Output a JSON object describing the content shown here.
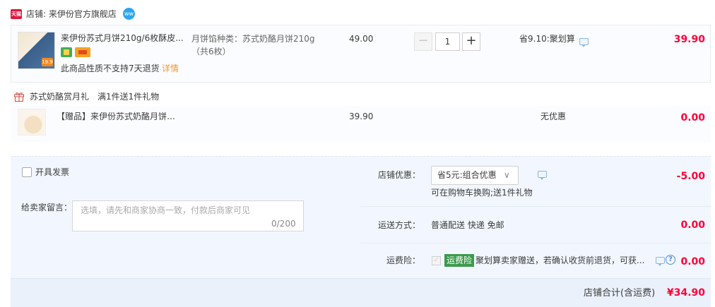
{
  "shop": {
    "badge": "天猫",
    "name": "店铺: 来伊份官方旗舰店",
    "chat_icon": "wangwang-icon"
  },
  "item": {
    "thumb_price": "19.9",
    "title": "来伊份苏式月饼210g/6枚酥皮...",
    "sku_line1": "月饼馅种类：苏式奶酪月饼210g",
    "sku_line2": "（共6枚）",
    "no_return": "此商品性质不支持7天退货",
    "detail": "详情",
    "unit_price": "49.00",
    "qty_minus": "−",
    "qty": "1",
    "qty_plus": "+",
    "promo": "省9.10:聚划算",
    "subtotal": "39.90"
  },
  "gift": {
    "section_title": "苏式奶酪赏月礼　满1件送1件礼物",
    "title": "【赠品】来伊份苏式奶酪月饼2...",
    "unit_price": "39.90",
    "promo": "无优惠",
    "subtotal": "0.00"
  },
  "options": {
    "invoice_label": "开具发票",
    "message_label": "给卖家留言：",
    "message_placeholder": "选填，请先和商家协商一致，付款后商家可见",
    "message_count": "0/200",
    "shop_discount_label": "店铺优惠：",
    "shop_discount_selected": "省5元:组合优惠",
    "shop_discount_hint": "可在购物车换购;送1件礼物",
    "shop_discount_amount": "-5.00",
    "shipping_label": "运送方式：",
    "shipping_value": "普通配送 快递 免邮",
    "shipping_amount": "0.00",
    "insurance_label": "运费险：",
    "insurance_badge": "运费险",
    "insurance_text": "聚划算卖家赠送，若确认收货前退货，可获...",
    "insurance_amount": "0.00",
    "help": "?"
  },
  "total": {
    "label": "店铺合计(含运费)",
    "amount": "¥34.90"
  },
  "colors": {
    "price_red": "#ff0036",
    "options_bg": "#f2f7ff",
    "link_orange": "#f29a2d",
    "insurance_green": "#3a9b4b"
  }
}
